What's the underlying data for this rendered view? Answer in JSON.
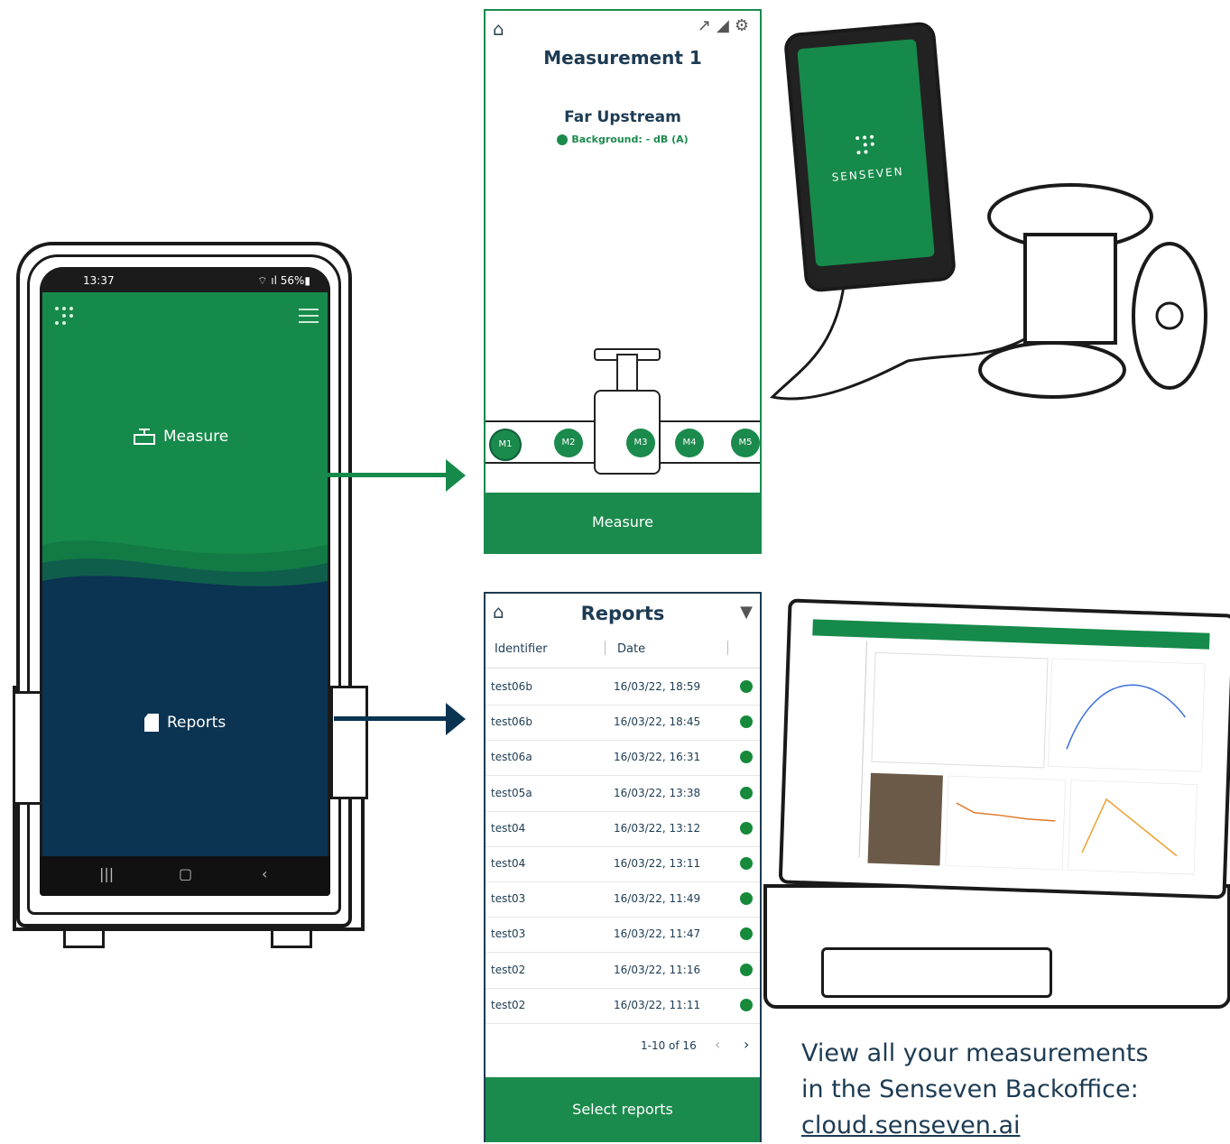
{
  "phone": {
    "time": "13:37",
    "battery": "56%",
    "measure_label": "Measure",
    "reports_label": "Reports"
  },
  "measurement_screen": {
    "title": "Measurement 1",
    "location": "Far Upstream",
    "background": "Background: - dB (A)",
    "points": [
      "M1",
      "M2",
      "M3",
      "M4",
      "M5"
    ],
    "button": "Measure"
  },
  "reports_screen": {
    "title": "Reports",
    "columns": [
      "Identifier",
      "Date"
    ],
    "rows": [
      {
        "id": "test06b",
        "date": "16/03/22, 18:59"
      },
      {
        "id": "test06b",
        "date": "16/03/22, 18:45"
      },
      {
        "id": "test06a",
        "date": "16/03/22, 16:31"
      },
      {
        "id": "test05a",
        "date": "16/03/22, 13:38"
      },
      {
        "id": "test04",
        "date": "16/03/22, 13:12"
      },
      {
        "id": "test04",
        "date": "16/03/22, 13:11"
      },
      {
        "id": "test03",
        "date": "16/03/22, 11:49"
      },
      {
        "id": "test03",
        "date": "16/03/22, 11:47"
      },
      {
        "id": "test02",
        "date": "16/03/22, 11:16"
      },
      {
        "id": "test02",
        "date": "16/03/22, 11:11"
      }
    ],
    "pagination": "1-10 of 16",
    "button": "Select reports"
  },
  "device": {
    "brand": "SENSEVEN"
  },
  "caption": {
    "line1": "View all your measurements",
    "line2": "in the Senseven Backoffice:",
    "link": "cloud.senseven.ai"
  },
  "colors": {
    "green": "#168a4a",
    "navy": "#0b3352",
    "text": "#1d3b53"
  },
  "icons": [
    "home-icon",
    "trend-icon",
    "signal-icon",
    "gear-icon",
    "filter-icon",
    "valve-icon",
    "report-icon",
    "menu-icon"
  ]
}
